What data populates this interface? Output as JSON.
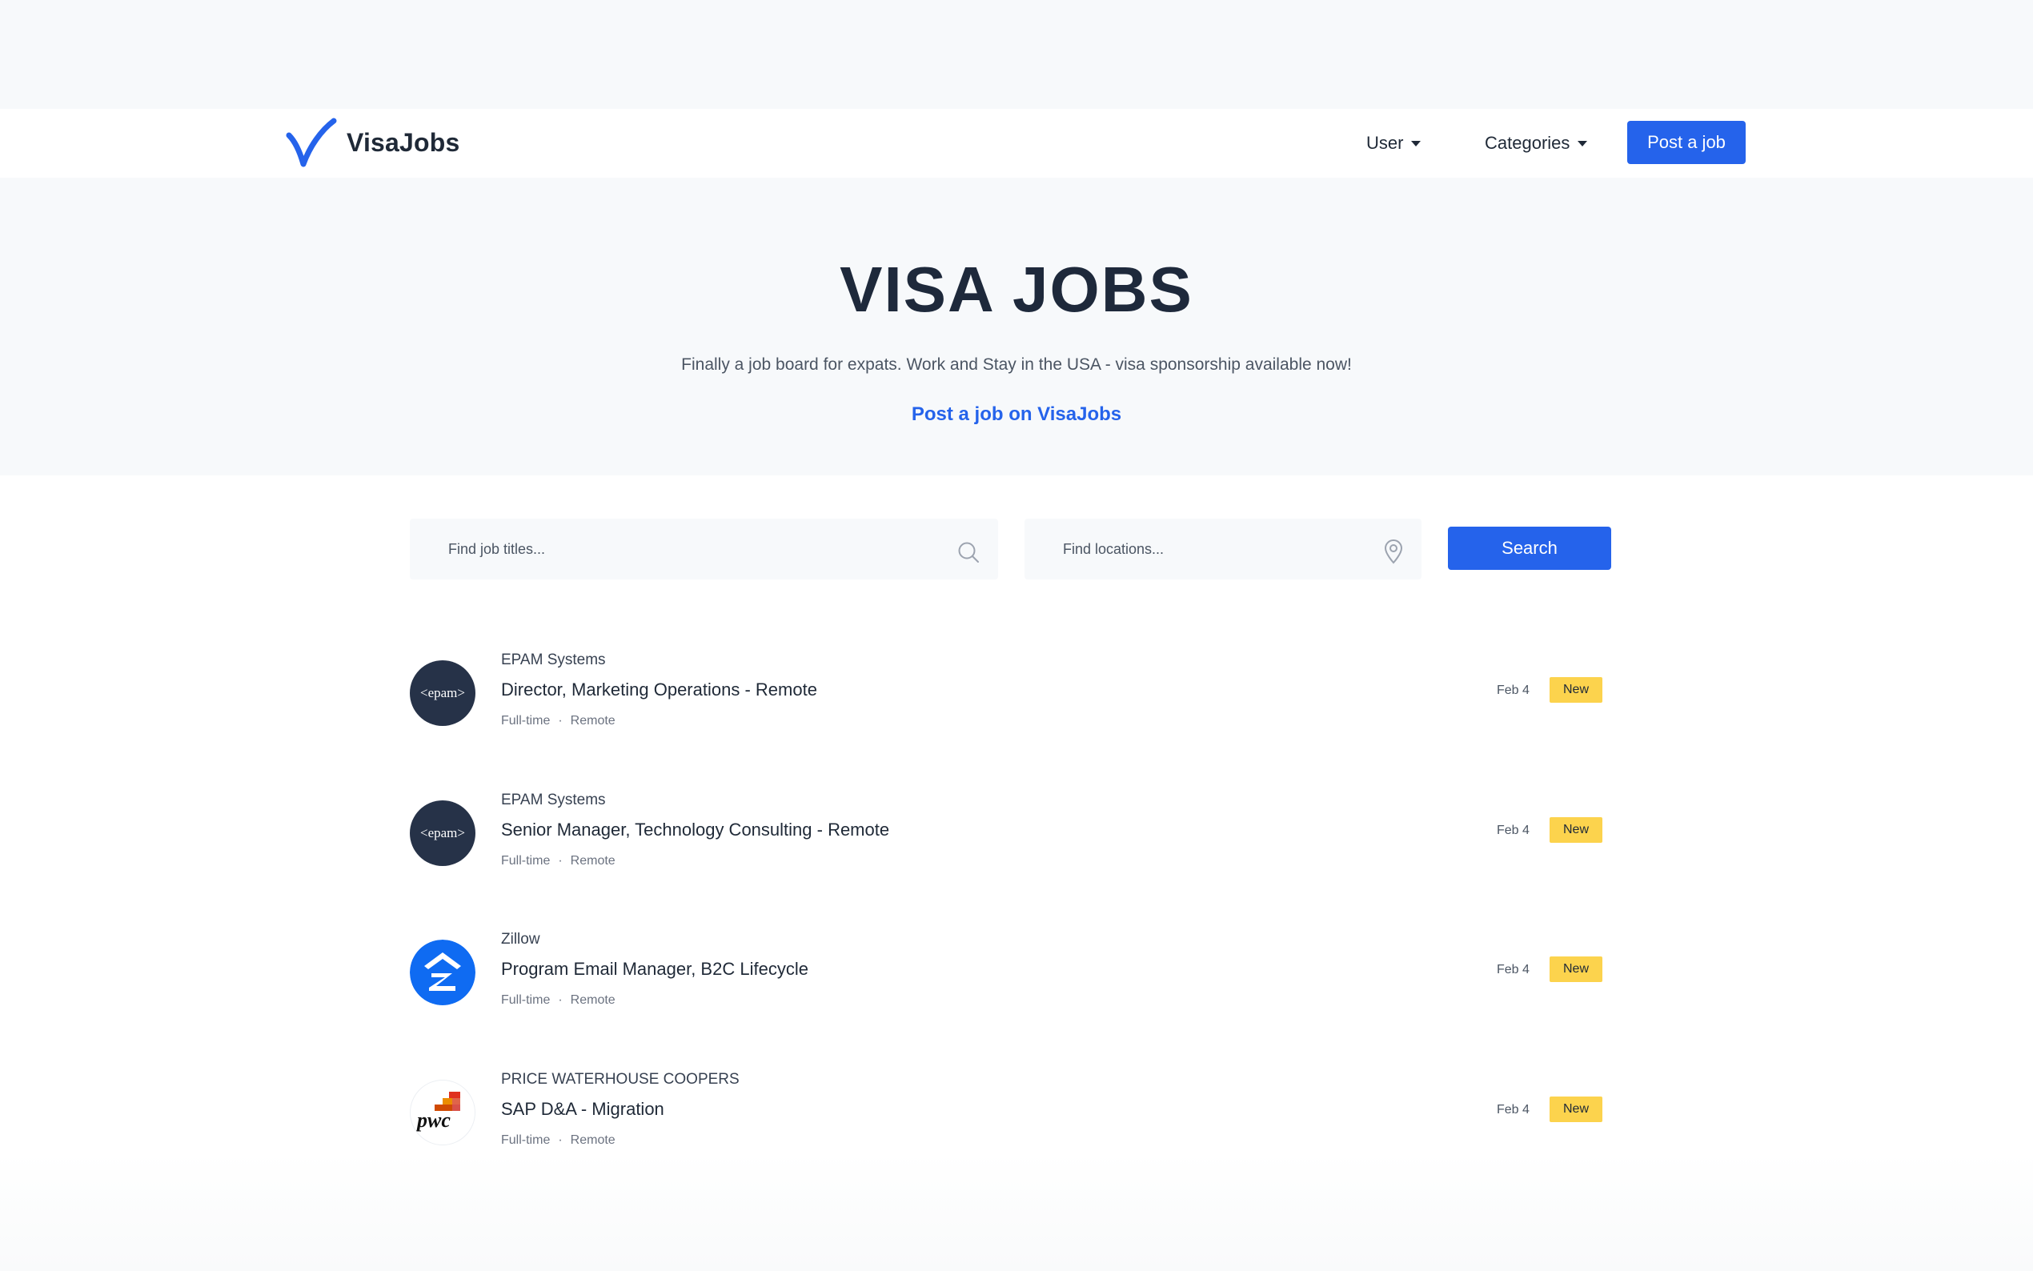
{
  "brand": {
    "name": "VisaJobs",
    "accent": "#2563eb"
  },
  "nav": {
    "user_label": "User",
    "categories_label": "Categories",
    "post_job_label": "Post a job"
  },
  "hero": {
    "title": "VISA JOBS",
    "subtitle": "Finally a job board for expats. Work and Stay in the USA - visa sponsorship available now!",
    "link_label": "Post a job on VisaJobs"
  },
  "search": {
    "title_placeholder": "Find job titles...",
    "location_placeholder": "Find locations...",
    "button_label": "Search"
  },
  "jobs": [
    {
      "company": "EPAM Systems",
      "title": "Director, Marketing Operations - Remote",
      "type": "Full-time",
      "location": "Remote",
      "date": "Feb 4",
      "badge": "New",
      "logo_text": "<epam>",
      "logo_icon": "epam-logo"
    },
    {
      "company": "EPAM Systems",
      "title": "Senior Manager, Technology Consulting - Remote",
      "type": "Full-time",
      "location": "Remote",
      "date": "Feb 4",
      "badge": "New",
      "logo_text": "<epam>",
      "logo_icon": "epam-logo"
    },
    {
      "company": "Zillow",
      "title": "Program Email Manager, B2C Lifecycle",
      "type": "Full-time",
      "location": "Remote",
      "date": "Feb 4",
      "badge": "New",
      "logo_icon": "zillow-logo"
    },
    {
      "company": "PRICE WATERHOUSE COOPERS",
      "title": "SAP D&A - Migration",
      "type": "Full-time",
      "location": "Remote",
      "date": "Feb 4",
      "badge": "New",
      "logo_text": "pwc",
      "logo_icon": "pwc-logo"
    }
  ],
  "meta_separator": "·"
}
